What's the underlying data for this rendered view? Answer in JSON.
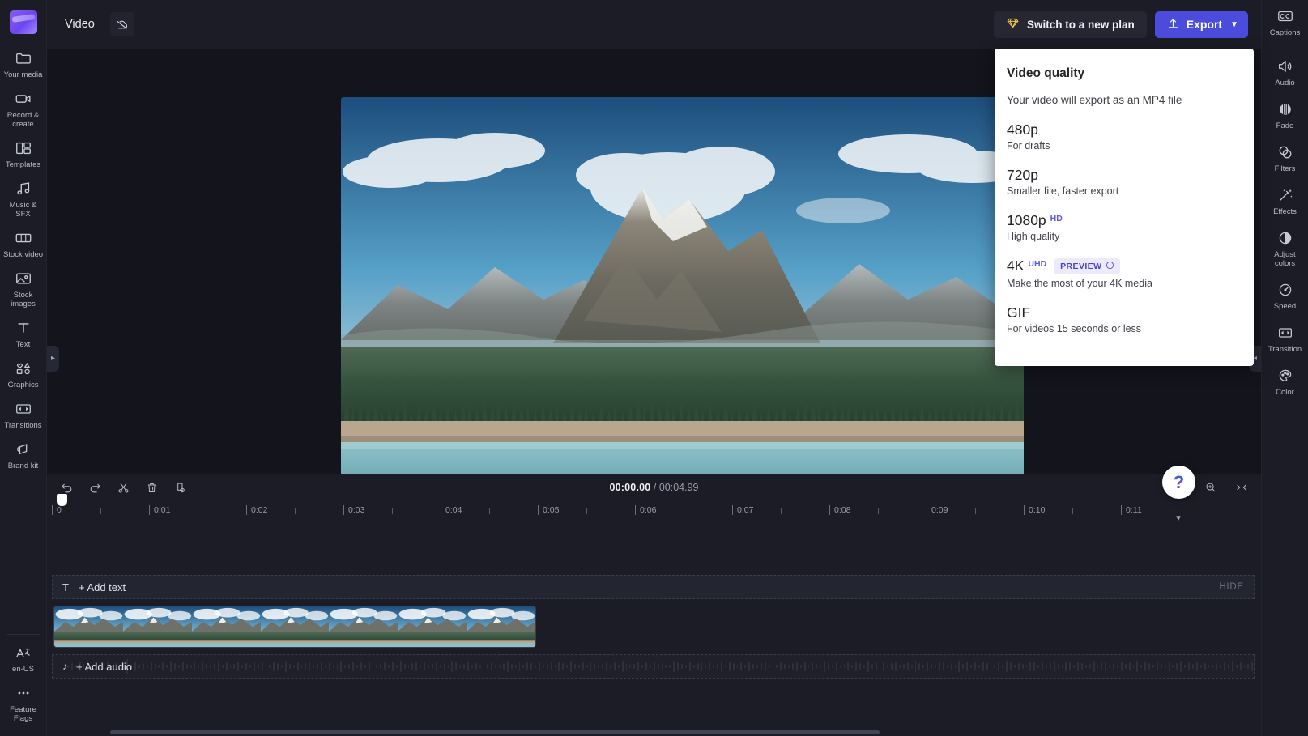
{
  "app": {
    "logo": "clipchamp-logo"
  },
  "topbar": {
    "project_title": "Video",
    "cloud_icon": "cloud-off-icon",
    "plan_button": {
      "label": "Switch to a new plan",
      "icon": "diamond-icon"
    },
    "export_button": {
      "label": "Export",
      "icon": "upload-arrow-icon",
      "chevron": "chevron-down-icon",
      "color": "#4b4bdc"
    }
  },
  "left_rail": {
    "items": [
      {
        "label": "Your media",
        "icon": "folder-icon"
      },
      {
        "label": "Record & create",
        "icon": "video-camera-icon"
      },
      {
        "label": "Templates",
        "icon": "templates-icon"
      },
      {
        "label": "Music & SFX",
        "icon": "music-note-icon"
      },
      {
        "label": "Stock video",
        "icon": "film-strip-icon"
      },
      {
        "label": "Stock images",
        "icon": "image-icon"
      },
      {
        "label": "Text",
        "icon": "text-t-icon"
      },
      {
        "label": "Graphics",
        "icon": "shapes-icon"
      },
      {
        "label": "Transitions",
        "icon": "transition-icon"
      },
      {
        "label": "Brand kit",
        "icon": "brand-kit-icon"
      }
    ],
    "bottom_items": [
      {
        "label": "en-US",
        "icon": "language-icon"
      },
      {
        "label": "Feature Flags",
        "icon": "ellipsis-icon"
      }
    ]
  },
  "right_rail": {
    "items": [
      {
        "label": "Captions",
        "icon": "closed-captions-icon"
      },
      {
        "label": "Audio",
        "icon": "speaker-icon"
      },
      {
        "label": "Fade",
        "icon": "fade-icon"
      },
      {
        "label": "Filters",
        "icon": "filters-icon"
      },
      {
        "label": "Effects",
        "icon": "magic-wand-icon"
      },
      {
        "label": "Adjust colors",
        "icon": "contrast-icon"
      },
      {
        "label": "Speed",
        "icon": "speedometer-icon"
      },
      {
        "label": "Transition",
        "icon": "transition-icon"
      },
      {
        "label": "Color",
        "icon": "palette-icon"
      }
    ]
  },
  "export_panel": {
    "title": "Video quality",
    "subtitle": "Your video will export as an MP4 file",
    "options": [
      {
        "name": "480p",
        "sup": "",
        "desc": "For drafts"
      },
      {
        "name": "720p",
        "sup": "",
        "desc": "Smaller file, faster export"
      },
      {
        "name": "1080p",
        "sup": "HD",
        "desc": "High quality"
      },
      {
        "name": "4K",
        "sup": "UHD",
        "badge": "PREVIEW",
        "desc": "Make the most of your 4K media"
      },
      {
        "name": "GIF",
        "sup": "",
        "desc": "For videos 15 seconds or less"
      }
    ],
    "badge_info_icon": "info-icon",
    "accent": "#5b5bd6"
  },
  "player": {
    "controls": [
      {
        "name": "skip-to-start",
        "icon": "skip-back-icon"
      },
      {
        "name": "rewind-5",
        "icon": "rewind-5s-icon"
      },
      {
        "name": "play",
        "icon": "play-icon"
      },
      {
        "name": "forward-5",
        "icon": "forward-5s-icon"
      },
      {
        "name": "skip-to-end",
        "icon": "skip-forward-icon"
      }
    ],
    "fullscreen_icon": "fullscreen-icon"
  },
  "help": {
    "label": "?",
    "icon": "question-mark-icon"
  },
  "timeline": {
    "tools": [
      {
        "name": "undo",
        "icon": "undo-icon"
      },
      {
        "name": "redo",
        "icon": "redo-icon"
      },
      {
        "name": "split",
        "icon": "scissors-icon"
      },
      {
        "name": "delete",
        "icon": "trash-icon"
      },
      {
        "name": "duplicate",
        "icon": "duplicate-icon"
      }
    ],
    "current_time": "00:00.00",
    "time_separator": " / ",
    "total_time": "00:04.99",
    "zoom_out_icon": "zoom-out-icon",
    "zoom_in_icon": "zoom-in-icon",
    "fit_icon": "fit-to-screen-icon",
    "ruler_labels": [
      "0",
      "0:01",
      "0:02",
      "0:03",
      "0:04",
      "0:05",
      "0:06",
      "0:07",
      "0:08",
      "0:09",
      "0:10",
      "0:11"
    ],
    "text_track": {
      "icon": "text-t-icon",
      "label": "+ Add text",
      "hide_label": "HIDE"
    },
    "audio_track": {
      "icon": "music-note-icon",
      "label": "+ Add audio"
    },
    "video_clip": {
      "frames": 7
    }
  }
}
